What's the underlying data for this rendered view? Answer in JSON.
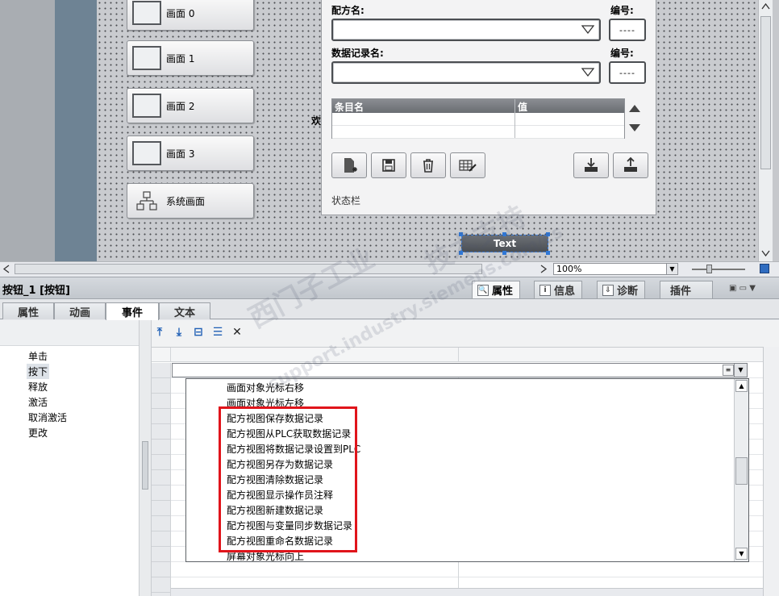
{
  "editor": {
    "screen_buttons": [
      {
        "label": "画面 0"
      },
      {
        "label": "画面 1"
      },
      {
        "label": "画面 2"
      },
      {
        "label": "画面 3"
      },
      {
        "label": "系统画面"
      }
    ],
    "welcome_text": "欢",
    "recipe_view": {
      "recipe_name_label": "配方名:",
      "number_label_1": "编号:",
      "record_name_label": "数据记录名:",
      "number_label_2": "编号:",
      "number_placeholder": "----",
      "table_headers": [
        "条目名",
        "值"
      ],
      "status_bar": "状态栏"
    },
    "text_object": "Text",
    "zoom": "100%"
  },
  "properties": {
    "title": "按钮_1 [按钮]",
    "inspector_tabs": [
      "属性",
      "信息",
      "诊断",
      "插件"
    ],
    "sub_tabs": [
      "属性",
      "动画",
      "事件",
      "文本"
    ],
    "active_sub_tab": "事件",
    "events": [
      "单击",
      "按下",
      "释放",
      "激活",
      "取消激活",
      "更改"
    ],
    "selected_event": "按下",
    "function_list": [
      "画面对象光标右移",
      "画面对象光标左移",
      "配方视图保存数据记录",
      "配方视图从PLC获取数据记录",
      "配方视图将数据记录设置到PLC",
      "配方视图另存为数据记录",
      "配方视图清除数据记录",
      "配方视图显示操作员注释",
      "配方视图新建数据记录",
      "配方视图与变量同步数据记录",
      "配方视图重命名数据记录",
      "屏幕对象光标向上"
    ]
  },
  "watermark": {
    "line1": "西门子工业",
    "line2": "support.industry.siemens.com/cs",
    "line3": "技术支持"
  },
  "colors": {
    "highlight_box": "#e0141b",
    "selection_blue": "#2f77d6"
  }
}
